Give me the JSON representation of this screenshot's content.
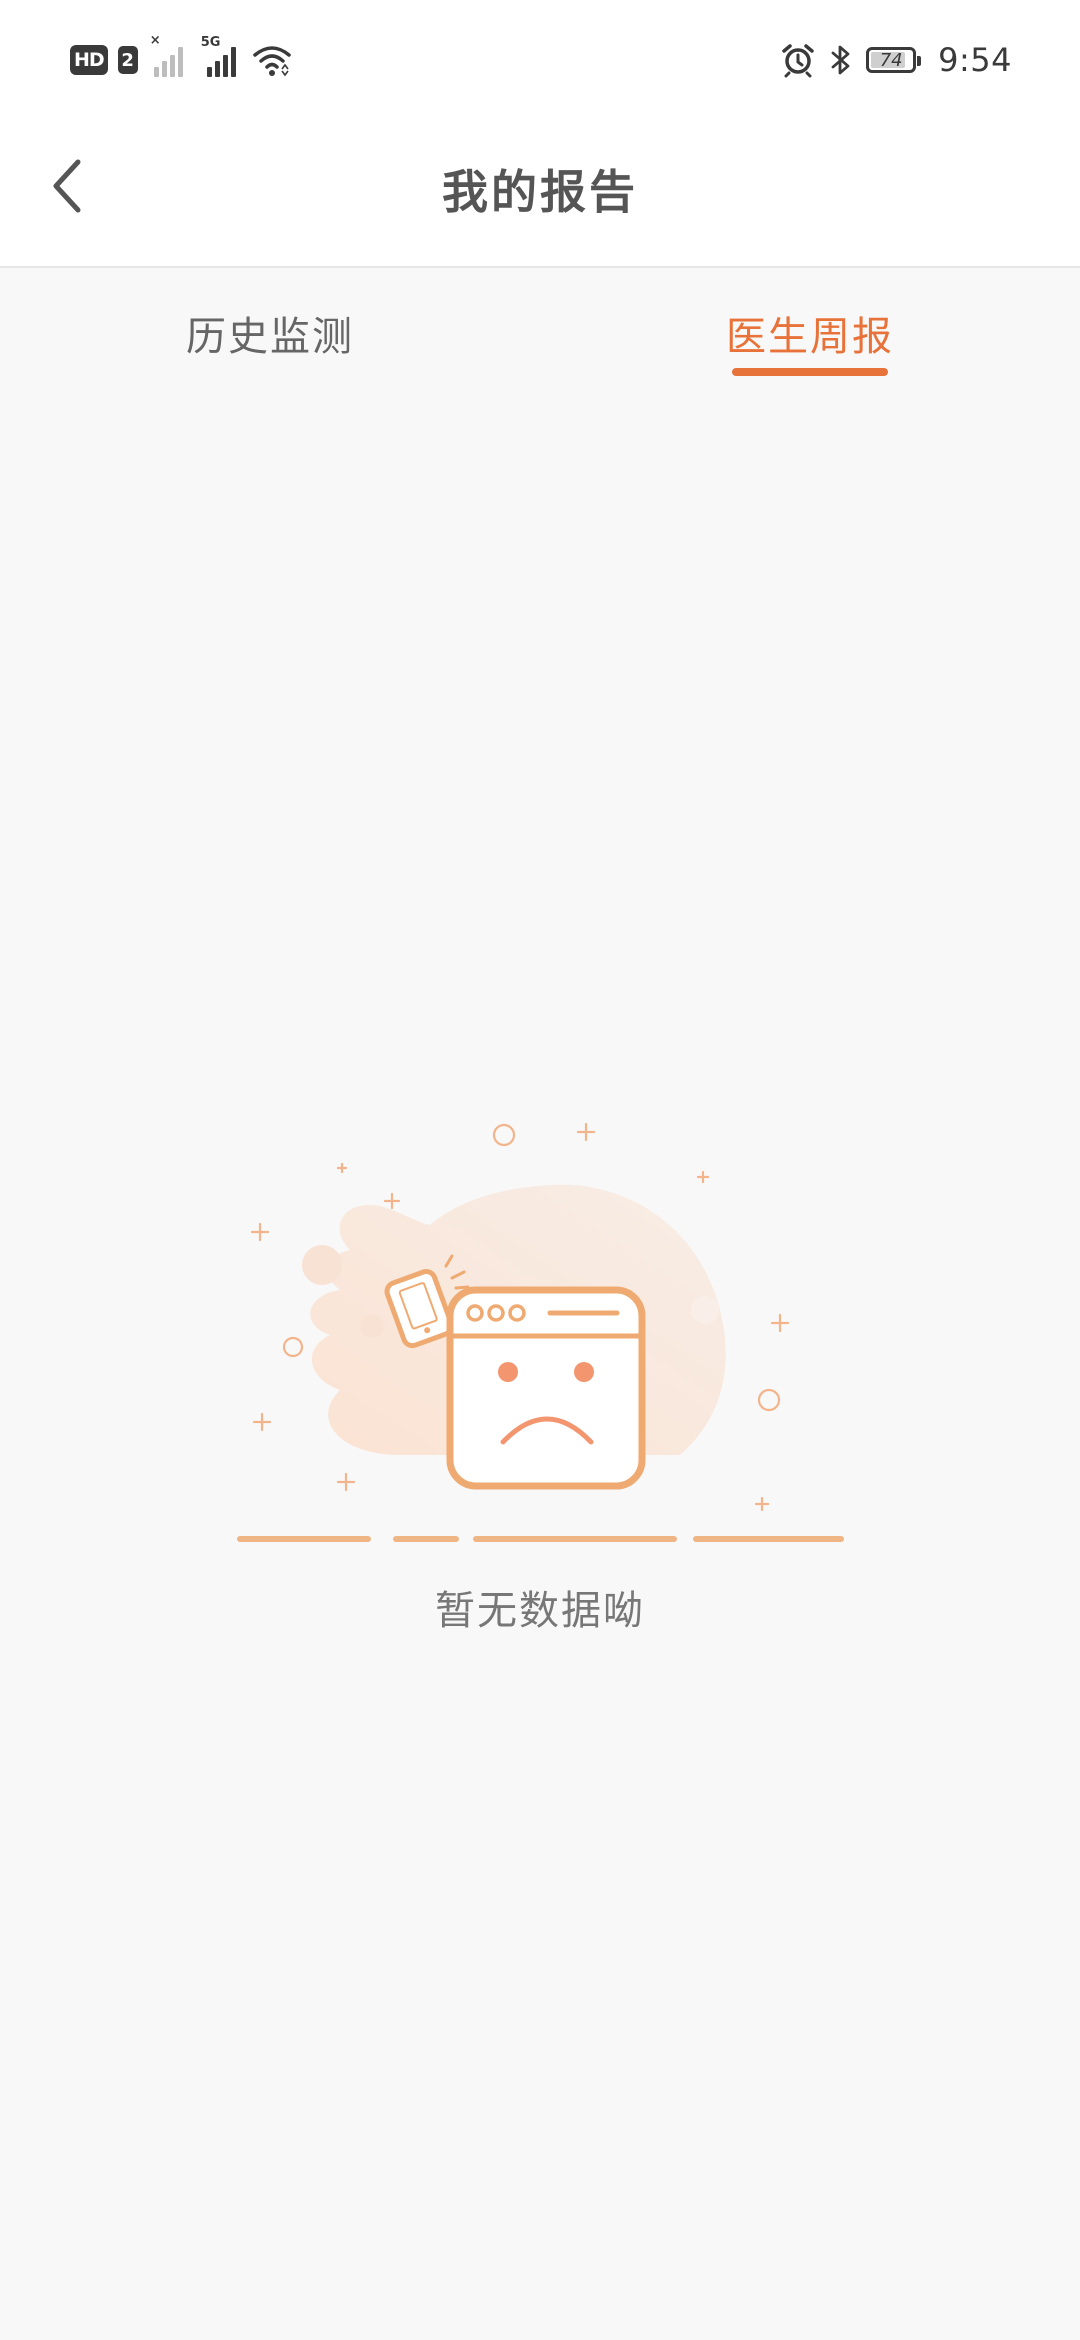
{
  "status_bar": {
    "hd_label": "HD",
    "sim_label": "2",
    "network_label": "5G",
    "battery_level": "74",
    "time": "9:54",
    "icons": [
      "signal-sim1-icon",
      "signal-5g-icon",
      "wifi-icon",
      "alarm-icon",
      "bluetooth-icon",
      "battery-icon"
    ]
  },
  "header": {
    "title": "我的报告",
    "back_icon": "chevron-left-icon"
  },
  "tabs": [
    {
      "label": "历史监测",
      "active": false
    },
    {
      "label": "医生周报",
      "active": true
    }
  ],
  "empty_state": {
    "message": "暂无数据呦",
    "illustration": "sad-window-icon"
  },
  "colors": {
    "accent": "#e8733a",
    "illustration_stroke": "#efaa72",
    "background": "#f8f8f8",
    "header_bg": "#ffffff"
  }
}
